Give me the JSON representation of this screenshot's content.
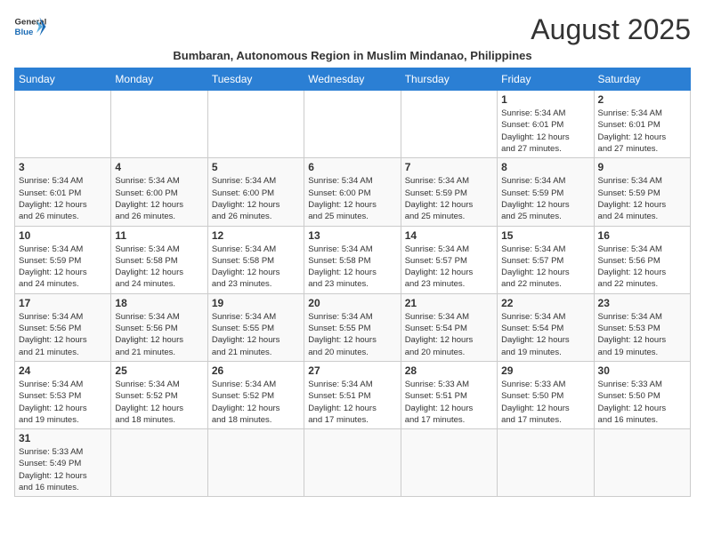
{
  "logo": {
    "line1": "General",
    "line2": "Blue"
  },
  "title": "August 2025",
  "subtitle": "Bumbaran, Autonomous Region in Muslim Mindanao, Philippines",
  "weekdays": [
    "Sunday",
    "Monday",
    "Tuesday",
    "Wednesday",
    "Thursday",
    "Friday",
    "Saturday"
  ],
  "weeks": [
    [
      {
        "day": "",
        "info": ""
      },
      {
        "day": "",
        "info": ""
      },
      {
        "day": "",
        "info": ""
      },
      {
        "day": "",
        "info": ""
      },
      {
        "day": "",
        "info": ""
      },
      {
        "day": "1",
        "info": "Sunrise: 5:34 AM\nSunset: 6:01 PM\nDaylight: 12 hours\nand 27 minutes."
      },
      {
        "day": "2",
        "info": "Sunrise: 5:34 AM\nSunset: 6:01 PM\nDaylight: 12 hours\nand 27 minutes."
      }
    ],
    [
      {
        "day": "3",
        "info": "Sunrise: 5:34 AM\nSunset: 6:01 PM\nDaylight: 12 hours\nand 26 minutes."
      },
      {
        "day": "4",
        "info": "Sunrise: 5:34 AM\nSunset: 6:00 PM\nDaylight: 12 hours\nand 26 minutes."
      },
      {
        "day": "5",
        "info": "Sunrise: 5:34 AM\nSunset: 6:00 PM\nDaylight: 12 hours\nand 26 minutes."
      },
      {
        "day": "6",
        "info": "Sunrise: 5:34 AM\nSunset: 6:00 PM\nDaylight: 12 hours\nand 25 minutes."
      },
      {
        "day": "7",
        "info": "Sunrise: 5:34 AM\nSunset: 5:59 PM\nDaylight: 12 hours\nand 25 minutes."
      },
      {
        "day": "8",
        "info": "Sunrise: 5:34 AM\nSunset: 5:59 PM\nDaylight: 12 hours\nand 25 minutes."
      },
      {
        "day": "9",
        "info": "Sunrise: 5:34 AM\nSunset: 5:59 PM\nDaylight: 12 hours\nand 24 minutes."
      }
    ],
    [
      {
        "day": "10",
        "info": "Sunrise: 5:34 AM\nSunset: 5:59 PM\nDaylight: 12 hours\nand 24 minutes."
      },
      {
        "day": "11",
        "info": "Sunrise: 5:34 AM\nSunset: 5:58 PM\nDaylight: 12 hours\nand 24 minutes."
      },
      {
        "day": "12",
        "info": "Sunrise: 5:34 AM\nSunset: 5:58 PM\nDaylight: 12 hours\nand 23 minutes."
      },
      {
        "day": "13",
        "info": "Sunrise: 5:34 AM\nSunset: 5:58 PM\nDaylight: 12 hours\nand 23 minutes."
      },
      {
        "day": "14",
        "info": "Sunrise: 5:34 AM\nSunset: 5:57 PM\nDaylight: 12 hours\nand 23 minutes."
      },
      {
        "day": "15",
        "info": "Sunrise: 5:34 AM\nSunset: 5:57 PM\nDaylight: 12 hours\nand 22 minutes."
      },
      {
        "day": "16",
        "info": "Sunrise: 5:34 AM\nSunset: 5:56 PM\nDaylight: 12 hours\nand 22 minutes."
      }
    ],
    [
      {
        "day": "17",
        "info": "Sunrise: 5:34 AM\nSunset: 5:56 PM\nDaylight: 12 hours\nand 21 minutes."
      },
      {
        "day": "18",
        "info": "Sunrise: 5:34 AM\nSunset: 5:56 PM\nDaylight: 12 hours\nand 21 minutes."
      },
      {
        "day": "19",
        "info": "Sunrise: 5:34 AM\nSunset: 5:55 PM\nDaylight: 12 hours\nand 21 minutes."
      },
      {
        "day": "20",
        "info": "Sunrise: 5:34 AM\nSunset: 5:55 PM\nDaylight: 12 hours\nand 20 minutes."
      },
      {
        "day": "21",
        "info": "Sunrise: 5:34 AM\nSunset: 5:54 PM\nDaylight: 12 hours\nand 20 minutes."
      },
      {
        "day": "22",
        "info": "Sunrise: 5:34 AM\nSunset: 5:54 PM\nDaylight: 12 hours\nand 19 minutes."
      },
      {
        "day": "23",
        "info": "Sunrise: 5:34 AM\nSunset: 5:53 PM\nDaylight: 12 hours\nand 19 minutes."
      }
    ],
    [
      {
        "day": "24",
        "info": "Sunrise: 5:34 AM\nSunset: 5:53 PM\nDaylight: 12 hours\nand 19 minutes."
      },
      {
        "day": "25",
        "info": "Sunrise: 5:34 AM\nSunset: 5:52 PM\nDaylight: 12 hours\nand 18 minutes."
      },
      {
        "day": "26",
        "info": "Sunrise: 5:34 AM\nSunset: 5:52 PM\nDaylight: 12 hours\nand 18 minutes."
      },
      {
        "day": "27",
        "info": "Sunrise: 5:34 AM\nSunset: 5:51 PM\nDaylight: 12 hours\nand 17 minutes."
      },
      {
        "day": "28",
        "info": "Sunrise: 5:33 AM\nSunset: 5:51 PM\nDaylight: 12 hours\nand 17 minutes."
      },
      {
        "day": "29",
        "info": "Sunrise: 5:33 AM\nSunset: 5:50 PM\nDaylight: 12 hours\nand 17 minutes."
      },
      {
        "day": "30",
        "info": "Sunrise: 5:33 AM\nSunset: 5:50 PM\nDaylight: 12 hours\nand 16 minutes."
      }
    ],
    [
      {
        "day": "31",
        "info": "Sunrise: 5:33 AM\nSunset: 5:49 PM\nDaylight: 12 hours\nand 16 minutes."
      },
      {
        "day": "",
        "info": ""
      },
      {
        "day": "",
        "info": ""
      },
      {
        "day": "",
        "info": ""
      },
      {
        "day": "",
        "info": ""
      },
      {
        "day": "",
        "info": ""
      },
      {
        "day": "",
        "info": ""
      }
    ]
  ]
}
